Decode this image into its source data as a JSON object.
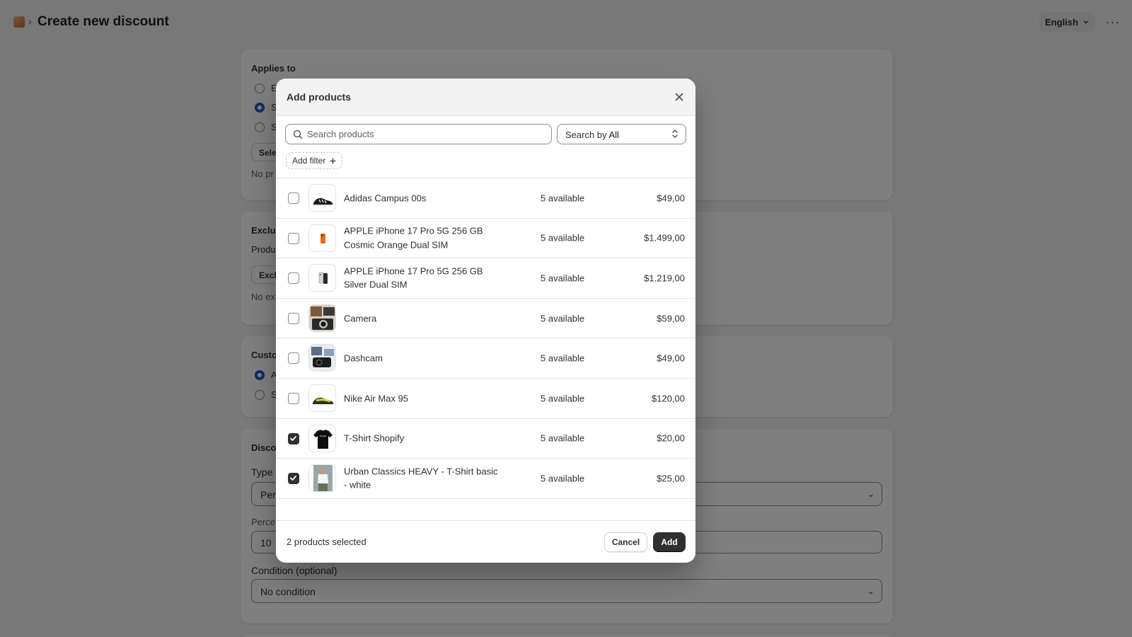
{
  "header": {
    "title": "Create new discount",
    "language": "English",
    "more_label": "···"
  },
  "background": {
    "applies_to": {
      "title": "Applies to",
      "options": [
        "E",
        "S",
        "S"
      ],
      "select_button": "Sele",
      "empty_text": "No pr"
    },
    "exclusions": {
      "title": "Exclus",
      "sub": "Produ",
      "button": "Excl",
      "empty_text": "No ex"
    },
    "customers": {
      "title": "Custo",
      "options": [
        "A",
        "S"
      ]
    },
    "discount": {
      "title": "Disco",
      "type_label": "Type",
      "type_value": "Perc",
      "percent_label": "Perce",
      "percent_value": "10",
      "condition_label": "Condition (optional)",
      "condition_value": "No condition"
    }
  },
  "modal": {
    "title": "Add products",
    "search": {
      "placeholder": "Search products"
    },
    "search_by": {
      "prefix": "Search by",
      "value": "All"
    },
    "add_filter": "Add filter",
    "products": [
      {
        "name": "Adidas Campus 00s",
        "available": "5 available",
        "price": "$49,00",
        "checked": false,
        "thumb": "sneaker"
      },
      {
        "name": "APPLE iPhone 17 Pro 5G 256 GB Cosmic Orange Dual SIM",
        "available": "5 available",
        "price": "$1.499,00",
        "checked": false,
        "thumb": "phone-orange"
      },
      {
        "name": "APPLE iPhone 17 Pro 5G 256 GB Silver Dual SIM",
        "available": "5 available",
        "price": "$1.219,00",
        "checked": false,
        "thumb": "phone-silver"
      },
      {
        "name": "Camera",
        "available": "5 available",
        "price": "$59,00",
        "checked": false,
        "thumb": "camera"
      },
      {
        "name": "Dashcam",
        "available": "5 available",
        "price": "$49,00",
        "checked": false,
        "thumb": "dashcam"
      },
      {
        "name": "Nike Air Max 95",
        "available": "5 available",
        "price": "$120,00",
        "checked": false,
        "thumb": "sneaker-yellow"
      },
      {
        "name": "T-Shirt Shopify",
        "available": "5 available",
        "price": "$20,00",
        "checked": true,
        "thumb": "tshirt-black"
      },
      {
        "name": "Urban Classics HEAVY - T-Shirt basic - white",
        "available": "5 available",
        "price": "$25,00",
        "checked": true,
        "thumb": "tshirt-white"
      }
    ],
    "footer": {
      "selected_text": "2 products selected",
      "cancel": "Cancel",
      "add": "Add"
    }
  }
}
